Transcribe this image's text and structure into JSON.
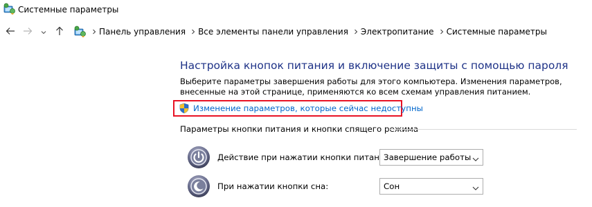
{
  "window": {
    "title": "Системные параметры",
    "title_icon": "control-panel-icon"
  },
  "nav": {
    "back_icon": "back-arrow-icon",
    "forward_icon": "forward-arrow-icon",
    "recent_icon": "chevron-down-icon",
    "up_icon": "up-arrow-icon"
  },
  "breadcrumb": {
    "icon": "control-panel-icon",
    "items": [
      "Панель управления",
      "Все элементы панели управления",
      "Электропитание",
      "Системные параметры"
    ]
  },
  "main": {
    "heading": "Настройка кнопок питания и включение защиты с помощью пароля",
    "description": "Выберите параметры завершения работы для этого компьютера. Изменения параметров, внесенные на этой странице, применяются ко всем схемам управления питанием.",
    "admin_link": "Изменение параметров, которые сейчас недоступны",
    "highlight_color": "#e81123",
    "heading_color": "#1e3287",
    "link_color": "#0066cc"
  },
  "power_buttons": {
    "group_label": "Параметры кнопки питания и кнопки спящего режима",
    "power_action_label": "Действие при нажатии кнопки питания:",
    "power_action_value": "Завершение работы",
    "sleep_action_label": "При нажатии кнопки сна:",
    "sleep_action_value": "Сон"
  }
}
